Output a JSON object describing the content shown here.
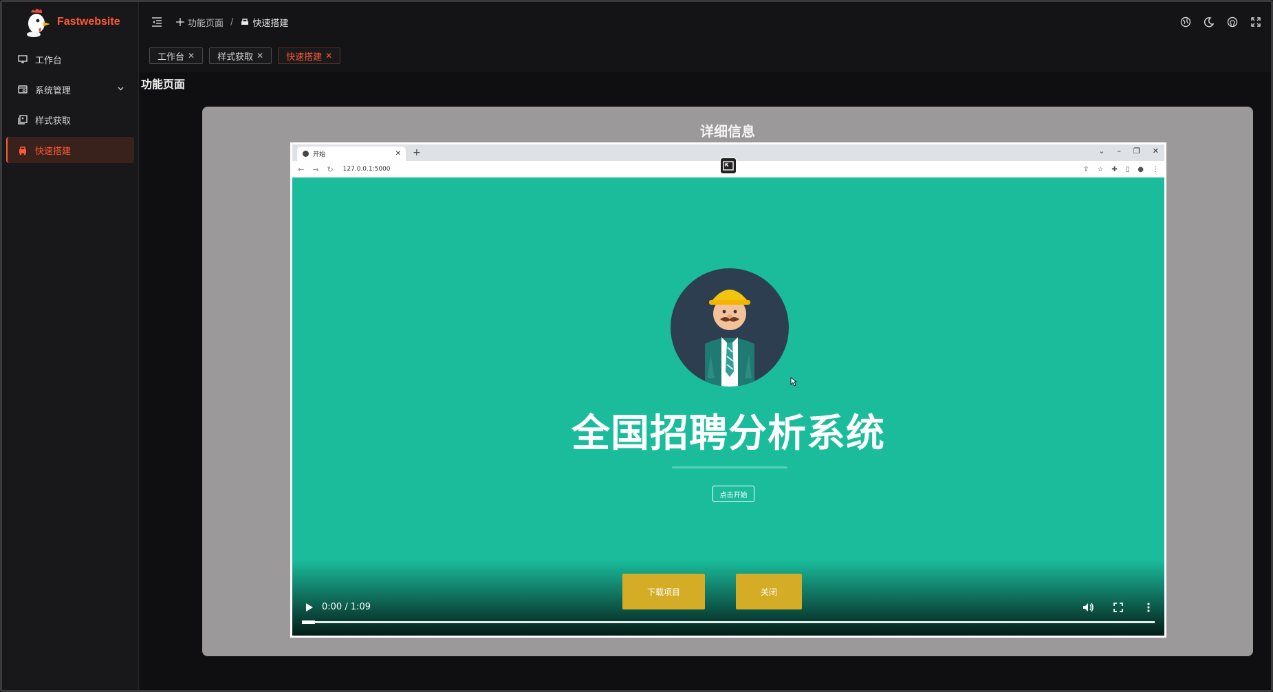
{
  "app": {
    "name": "Fastwebsite",
    "accent": "#ff5a36"
  },
  "sidebar": {
    "items": [
      {
        "label": "工作台",
        "icon": "monitor-icon"
      },
      {
        "label": "系统管理",
        "icon": "settings-panel-icon",
        "has_children": true
      },
      {
        "label": "样式获取",
        "icon": "gallery-icon"
      },
      {
        "label": "快速搭建",
        "icon": "build-icon",
        "active": true
      }
    ]
  },
  "header": {
    "breadcrumb": [
      {
        "label": "功能页面"
      },
      {
        "label": "快速搭建"
      }
    ],
    "tools": [
      "language-icon",
      "dark-mode-icon",
      "github-icon",
      "fullscreen-icon"
    ]
  },
  "tabs": [
    {
      "label": "工作台",
      "active": false
    },
    {
      "label": "样式获取",
      "active": false
    },
    {
      "label": "快速搭建",
      "active": true
    }
  ],
  "page": {
    "title": "功能页面"
  },
  "dialog": {
    "title": "详细信息",
    "video": {
      "browser_tab_title": "开始",
      "url": "127.0.0.1:5000",
      "headline": "全国招聘分析系统",
      "start_button": "点击开始",
      "time": "0:00 / 1:09",
      "progress_fraction": 0.015,
      "bg_color": "#1abc9c"
    },
    "buttons": {
      "download": "下载项目",
      "close": "关闭"
    }
  }
}
